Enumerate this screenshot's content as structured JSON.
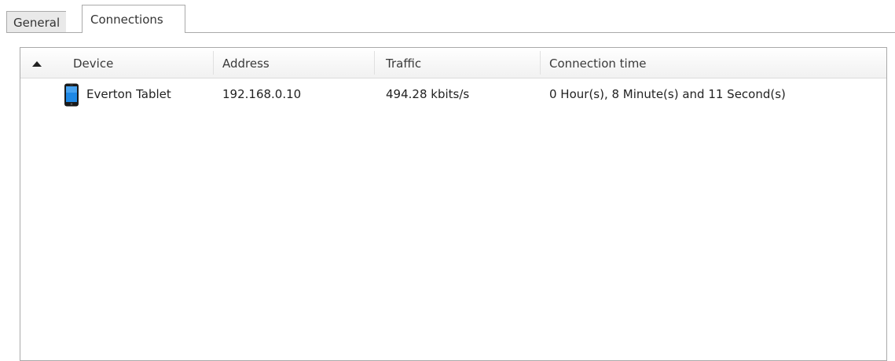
{
  "tabs": {
    "general": "General",
    "connections": "Connections"
  },
  "table": {
    "sort_column": "Device",
    "sort_direction": "ascending",
    "columns": {
      "device": "Device",
      "address": "Address",
      "traffic": "Traffic",
      "connection_time": "Connection time"
    },
    "rows": [
      {
        "icon": "tablet-icon",
        "device": "Everton Tablet",
        "address": "192.168.0.10",
        "traffic": "494.28 kbits/s",
        "connection_time": "0 Hour(s), 8 Minute(s) and 11 Second(s)"
      }
    ]
  },
  "colors": {
    "device_icon_screen": "#1e88e5",
    "border": "#a9a9a9"
  }
}
